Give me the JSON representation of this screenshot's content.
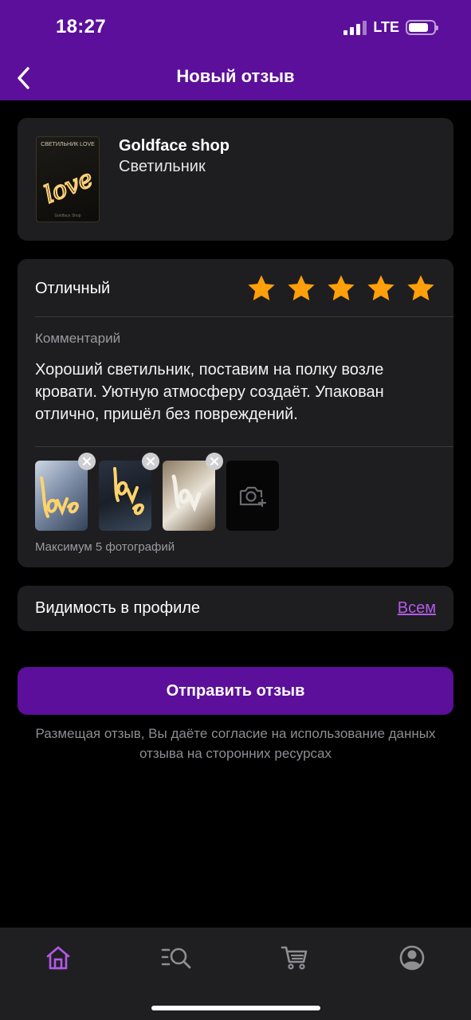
{
  "status_bar": {
    "time": "18:27",
    "network": "LTE",
    "battery_level": 0.8
  },
  "nav": {
    "title": "Новый отзыв",
    "back_icon": "chevron-left-icon"
  },
  "product": {
    "image_caption": "СВЕТИЛЬНИК LOVE",
    "image_word": "love",
    "image_brand": "Goldface Shop",
    "shop_name": "Goldface shop",
    "product_name": "Светильник"
  },
  "review": {
    "rating_label": "Отличный",
    "rating": 5,
    "max_rating": 5,
    "star_color": "#ff9f0a",
    "comment_label": "Комментарий",
    "comment_text": "Хороший светильник, поставим на полку возле кровати. Уютную атмосферу создаёт. Упакован отлично, пришёл без повреждений.",
    "photos_count": 3,
    "photo_hint": "Максимум 5 фотографий",
    "add_photo_icon": "camera-plus-icon"
  },
  "visibility": {
    "label": "Видимость в профиле",
    "value": "Всем"
  },
  "submit": {
    "label": "Отправить отзыв"
  },
  "disclaimer": "Размещая отзыв, Вы даёте согласие на использование данных отзыва на сторонних ресурсах",
  "tab_bar": {
    "items": [
      {
        "icon": "home-icon",
        "active": true
      },
      {
        "icon": "catalog-search-icon",
        "active": false
      },
      {
        "icon": "cart-icon",
        "active": false
      },
      {
        "icon": "profile-icon",
        "active": false
      }
    ],
    "active_color": "#b35ae8",
    "inactive_color": "#8e8e93"
  },
  "colors": {
    "accent": "#5b0f9a",
    "link": "#b35ae8",
    "card": "#1e1e21"
  }
}
